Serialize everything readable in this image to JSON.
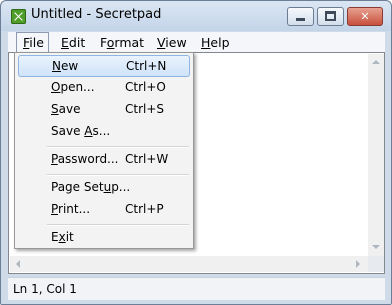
{
  "window": {
    "title": "Untitled - Secretpad",
    "close_glyph": "✕"
  },
  "menubar": {
    "items": [
      {
        "label": "File",
        "mnemonic": "F"
      },
      {
        "label": "Edit",
        "mnemonic": "E"
      },
      {
        "label": "Format",
        "mnemonic": "o"
      },
      {
        "label": "View",
        "mnemonic": "V"
      },
      {
        "label": "Help",
        "mnemonic": "H"
      }
    ]
  },
  "file_menu": {
    "items": [
      {
        "label": "New",
        "shortcut": "Ctrl+N",
        "mnemonic_index": 0,
        "highlighted": true
      },
      {
        "label": "Open...",
        "shortcut": "Ctrl+O",
        "mnemonic_index": 0
      },
      {
        "label": "Save",
        "shortcut": "Ctrl+S",
        "mnemonic_index": 0
      },
      {
        "label": "Save As...",
        "shortcut": "",
        "mnemonic_index": 5
      },
      {
        "label": "Password...",
        "shortcut": "Ctrl+W",
        "mnemonic_index": 0
      },
      {
        "label": "Page Setup...",
        "shortcut": "",
        "mnemonic_index": 8
      },
      {
        "label": "Print...",
        "shortcut": "Ctrl+P",
        "mnemonic_index": 0
      },
      {
        "label": "Exit",
        "shortcut": "",
        "mnemonic_index": 1
      }
    ]
  },
  "editor": {
    "content": ""
  },
  "statusbar": {
    "position": "Ln 1, Col 1"
  },
  "colors": {
    "highlight_border": "#8fb5e3",
    "highlight_fill": "#d9e9fb",
    "app_icon": "#4f9e2a",
    "close_button": "#c8513d"
  }
}
